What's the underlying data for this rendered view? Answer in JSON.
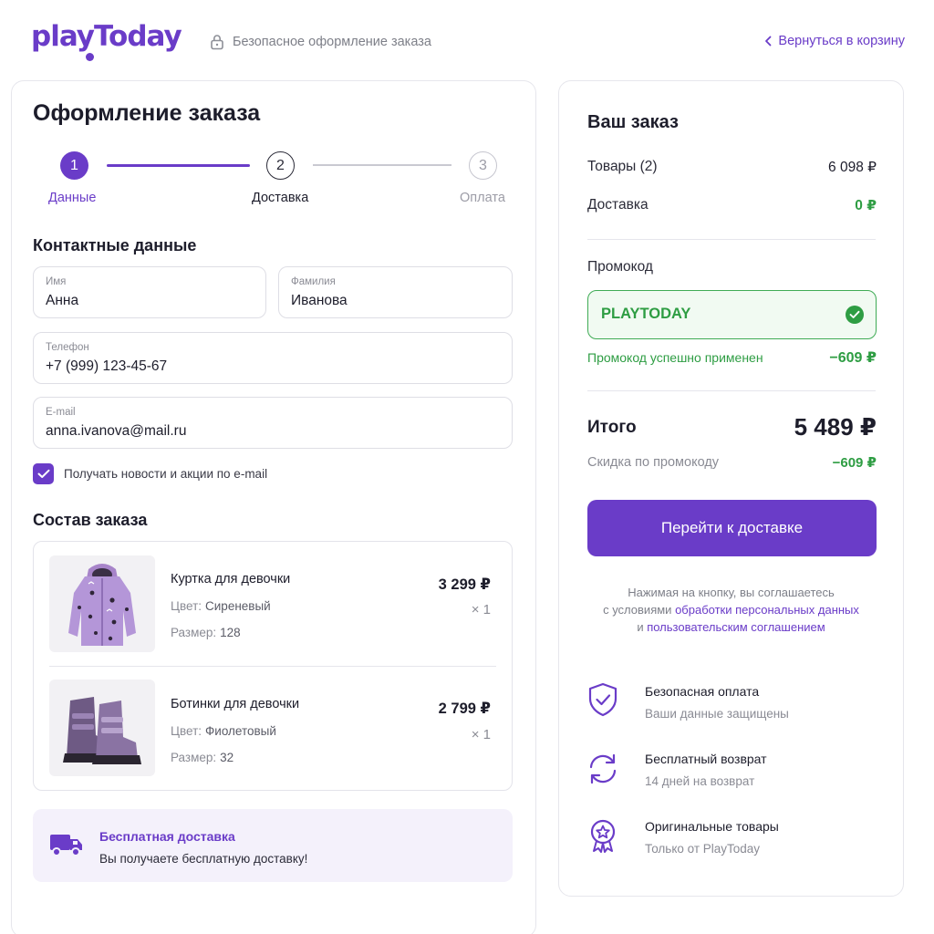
{
  "header": {
    "logo": "playToday",
    "secure_label": "Безопасное оформление заказа",
    "back_link": "Вернуться в корзину"
  },
  "checkout": {
    "title": "Оформление заказа",
    "steps": [
      {
        "number": "1",
        "label": "Данные",
        "state": "active"
      },
      {
        "number": "2",
        "label": "Доставка",
        "state": "next"
      },
      {
        "number": "3",
        "label": "Оплата",
        "state": "disabled"
      }
    ],
    "contact": {
      "title": "Контактные данные",
      "first_name": {
        "label": "Имя",
        "value": "Анна"
      },
      "last_name": {
        "label": "Фамилия",
        "value": "Иванова"
      },
      "phone": {
        "label": "Телефон",
        "value": "+7 (999) 123-45-67"
      },
      "email": {
        "label": "E-mail",
        "value": "anna.ivanova@mail.ru"
      },
      "newsletter": {
        "label": "Получать новости и акции по e-mail",
        "checked": true
      }
    },
    "order": {
      "title": "Состав заказа",
      "items": [
        {
          "name": "Куртка для девочки",
          "color_label": "Цвет:",
          "color": "Сиреневый",
          "size_label": "Размер:",
          "size": "128",
          "price": "3 299 ₽",
          "qty": "× 1"
        },
        {
          "name": "Ботинки для девочки",
          "color_label": "Цвет:",
          "color": "Фиолетовый",
          "size_label": "Размер:",
          "size": "32",
          "price": "2 799 ₽",
          "qty": "× 1"
        }
      ]
    },
    "free_delivery": {
      "title": "Бесплатная доставка",
      "text": "Вы получаете бесплатную доставку!"
    }
  },
  "summary": {
    "title": "Ваш заказ",
    "goods_label": "Товары (2)",
    "goods_value": "6 098 ₽",
    "delivery_label": "Доставка",
    "delivery_value": "0 ₽",
    "promo_label": "Промокод",
    "promo_code": "PLAYTODAY",
    "promo_status": "Промокод успешно применен",
    "promo_discount": "−609 ₽",
    "total_label": "Итого",
    "total_value": "5 489 ₽",
    "discount_label": "Скидка по промокоду",
    "discount_value": "−609 ₽",
    "cta_label": "Перейти к доставке",
    "agree_text_1": "Нажимая на кнопку, вы соглашаетесь",
    "agree_text_2": "с условиями",
    "agree_link_1": "обработки персональных данных",
    "agree_text_3": "и",
    "agree_link_2": "пользовательским соглашением",
    "features": [
      {
        "icon": "shield-check-icon",
        "title": "Безопасная оплата",
        "subtitle": "Ваши данные защищены"
      },
      {
        "icon": "refresh-icon",
        "title": "Бесплатный возврат",
        "subtitle": "14 дней на возврат"
      },
      {
        "icon": "badge-star-icon",
        "title": "Оригинальные товары",
        "subtitle": "Только от PlayToday"
      }
    ]
  },
  "colors": {
    "brand": "#6a3cc8",
    "success": "#2e9d43",
    "muted": "#8a8b94"
  }
}
